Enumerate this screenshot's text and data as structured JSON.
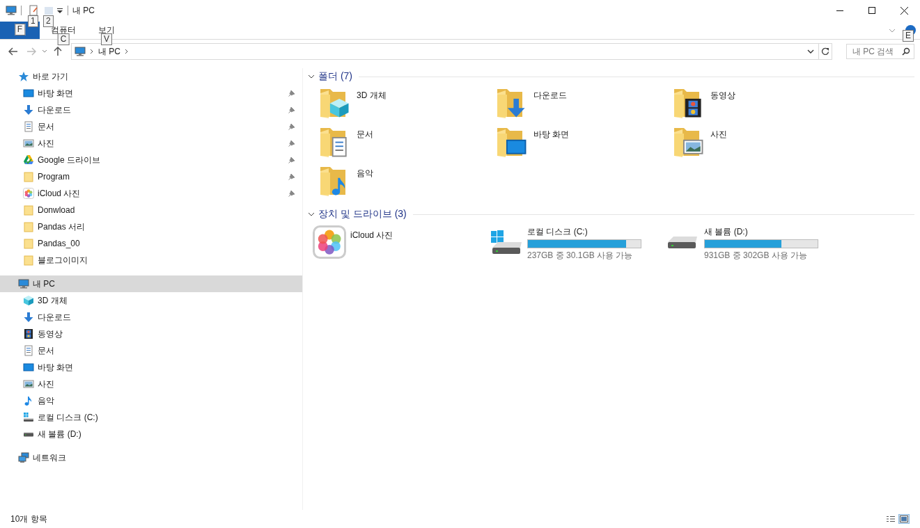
{
  "window": {
    "title": "내 PC"
  },
  "quick_toolbar": [
    {
      "kind": "properties",
      "keytip": "1",
      "disabled": false
    },
    {
      "kind": "newfolder",
      "keytip": "2",
      "disabled": true
    }
  ],
  "ribbon": {
    "tabs": [
      {
        "keytip": "F",
        "selected": true
      },
      {
        "label": "컴퓨터",
        "keytip": "C",
        "selected": false
      },
      {
        "label": "보기",
        "keytip": "V",
        "selected": false
      }
    ],
    "help_keytip": "E"
  },
  "nav": {
    "back_disabled": false,
    "forward_disabled": true
  },
  "address": {
    "path": [
      "내 PC"
    ]
  },
  "search": {
    "placeholder": "내 PC 검색"
  },
  "sidebar": {
    "groups": [
      {
        "label": "바로 가기",
        "kind": "quickaccess",
        "selected": false,
        "children": [
          {
            "label": "바탕 화면",
            "kind": "desktop",
            "pinned": true,
            "selected": false
          },
          {
            "label": "다운로드",
            "kind": "downloads",
            "pinned": true,
            "selected": false
          },
          {
            "label": "문서",
            "kind": "documents",
            "pinned": true,
            "selected": false
          },
          {
            "label": "사진",
            "kind": "pictures",
            "pinned": true,
            "selected": false
          },
          {
            "label": "Google 드라이브",
            "kind": "gdrive",
            "pinned": true,
            "selected": false
          },
          {
            "label": "Program",
            "kind": "folder",
            "pinned": true,
            "selected": false
          },
          {
            "label": "iCloud 사진",
            "kind": "photos",
            "pinned": true,
            "selected": false
          },
          {
            "label": "Donwload",
            "kind": "folder",
            "pinned": false,
            "selected": false
          },
          {
            "label": "Pandas 서리",
            "kind": "folder",
            "pinned": false,
            "selected": false
          },
          {
            "label": "Pandas_00",
            "kind": "folder",
            "pinned": false,
            "selected": false
          },
          {
            "label": "블로그이미지",
            "kind": "folder",
            "pinned": false,
            "selected": false
          }
        ]
      },
      {
        "label": "내 PC",
        "kind": "computer",
        "selected": true,
        "children": [
          {
            "label": "3D 개체",
            "kind": "objects3d",
            "selected": false
          },
          {
            "label": "다운로드",
            "kind": "downloads",
            "selected": false
          },
          {
            "label": "동영상",
            "kind": "videos",
            "selected": false
          },
          {
            "label": "문서",
            "kind": "documents",
            "selected": false
          },
          {
            "label": "바탕 화면",
            "kind": "desktop",
            "selected": false
          },
          {
            "label": "사진",
            "kind": "pictures",
            "selected": false
          },
          {
            "label": "음악",
            "kind": "music",
            "selected": false
          },
          {
            "label": "로컬 디스크 (C:)",
            "kind": "windrive",
            "selected": false
          },
          {
            "label": "새 볼륨 (D:)",
            "kind": "drive",
            "selected": false
          }
        ]
      },
      {
        "label": "네트워크",
        "kind": "network",
        "selected": false
      }
    ]
  },
  "content": {
    "groups": [
      {
        "label": "폴더",
        "count": "(7)",
        "expanded": true,
        "items": [
          {
            "label": "3D 개체",
            "kind": "objects3d"
          },
          {
            "label": "다운로드",
            "kind": "downloads"
          },
          {
            "label": "동영상",
            "kind": "videos"
          },
          {
            "label": "문서",
            "kind": "documents"
          },
          {
            "label": "바탕 화면",
            "kind": "desktop"
          },
          {
            "label": "사진",
            "kind": "pictures"
          },
          {
            "label": "음악",
            "kind": "music"
          }
        ]
      },
      {
        "label": "장치 및 드라이브",
        "count": "(3)",
        "expanded": true,
        "items": [
          {
            "label": "iCloud 사진",
            "kind": "photos"
          },
          {
            "label": "로컬 디스크 (C:)",
            "kind": "windrive",
            "level": 0.873,
            "free": "237GB 중 30.1GB 사용 가능"
          },
          {
            "label": "새 볼륨 (D:)",
            "kind": "drive",
            "level": 0.676,
            "free": "931GB 중 302GB 사용 가능"
          }
        ]
      }
    ]
  },
  "status_bar": {
    "count": "10개 항목",
    "views": [
      {
        "kind": "details",
        "selected": false
      },
      {
        "kind": "tiles",
        "selected": true
      }
    ]
  }
}
